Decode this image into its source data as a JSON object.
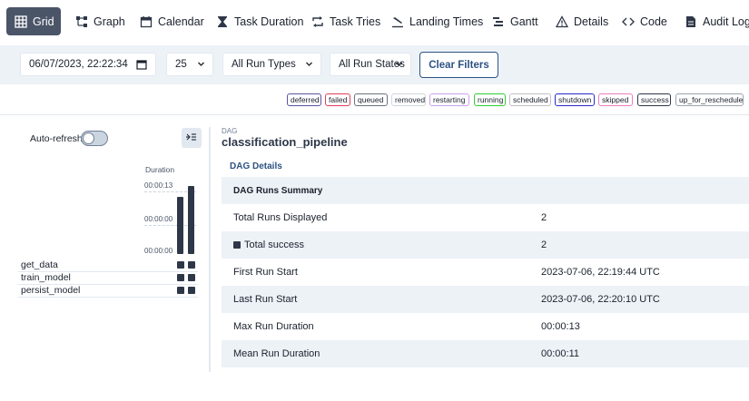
{
  "tabs": [
    {
      "label": "Grid",
      "icon": "grid-icon",
      "active": true
    },
    {
      "label": "Graph",
      "icon": "graph-icon"
    },
    {
      "label": "Calendar",
      "icon": "calendar-icon"
    },
    {
      "label": "Task Duration",
      "icon": "hourglass-icon"
    },
    {
      "label": "Task Tries",
      "icon": "retry-icon"
    },
    {
      "label": "Landing Times",
      "icon": "landing-icon"
    },
    {
      "label": "Gantt",
      "icon": "gantt-icon"
    },
    {
      "label": "Details",
      "icon": "warning-icon"
    },
    {
      "label": "Code",
      "icon": "code-icon"
    },
    {
      "label": "Audit Log",
      "icon": "audit-icon"
    }
  ],
  "filters": {
    "datetime": "06/07/2023, 22:22:34",
    "num_runs": "25",
    "run_type": "All Run Types",
    "run_state": "All Run States",
    "clear_label": "Clear Filters"
  },
  "legend": [
    {
      "label": "deferred",
      "color": "#5a55a0"
    },
    {
      "label": "failed",
      "color": "#e0405a"
    },
    {
      "label": "queued",
      "color": "#6b7280"
    },
    {
      "label": "removed",
      "color": "#d1d5db"
    },
    {
      "label": "restarting",
      "color": "#c8a2e8"
    },
    {
      "label": "running",
      "color": "#32cd32"
    },
    {
      "label": "scheduled",
      "color": "#c0c0c0"
    },
    {
      "label": "shutdown",
      "color": "#2929c8"
    },
    {
      "label": "skipped",
      "color": "#e87ec0"
    },
    {
      "label": "success",
      "color": "#2d3748"
    },
    {
      "label": "up_for_reschedule",
      "color": "#9ca3af"
    }
  ],
  "grid": {
    "auto_refresh_label": "Auto-refresh",
    "auto_refresh_on": false,
    "duration_label": "Duration",
    "ticks": [
      "00:00:13",
      "00:00:00",
      "00:00:00"
    ],
    "run_durations_sec": [
      11,
      13
    ],
    "max_duration_sec": 13,
    "tasks": [
      "get_data",
      "train_model",
      "persist_model"
    ]
  },
  "details": {
    "dag_label": "DAG",
    "dag_id": "classification_pipeline",
    "tab_label": "DAG Details",
    "summary_label": "DAG Runs Summary",
    "rows": [
      {
        "key": "Total Runs Displayed",
        "value": "2"
      },
      {
        "key": "Total success",
        "value": "2"
      },
      {
        "key": "First Run Start",
        "value": "2023-07-06, 22:19:44 UTC"
      },
      {
        "key": "Last Run Start",
        "value": "2023-07-06, 22:20:10 UTC"
      },
      {
        "key": "Max Run Duration",
        "value": "00:00:13"
      },
      {
        "key": "Mean Run Duration",
        "value": "00:00:11"
      }
    ]
  }
}
